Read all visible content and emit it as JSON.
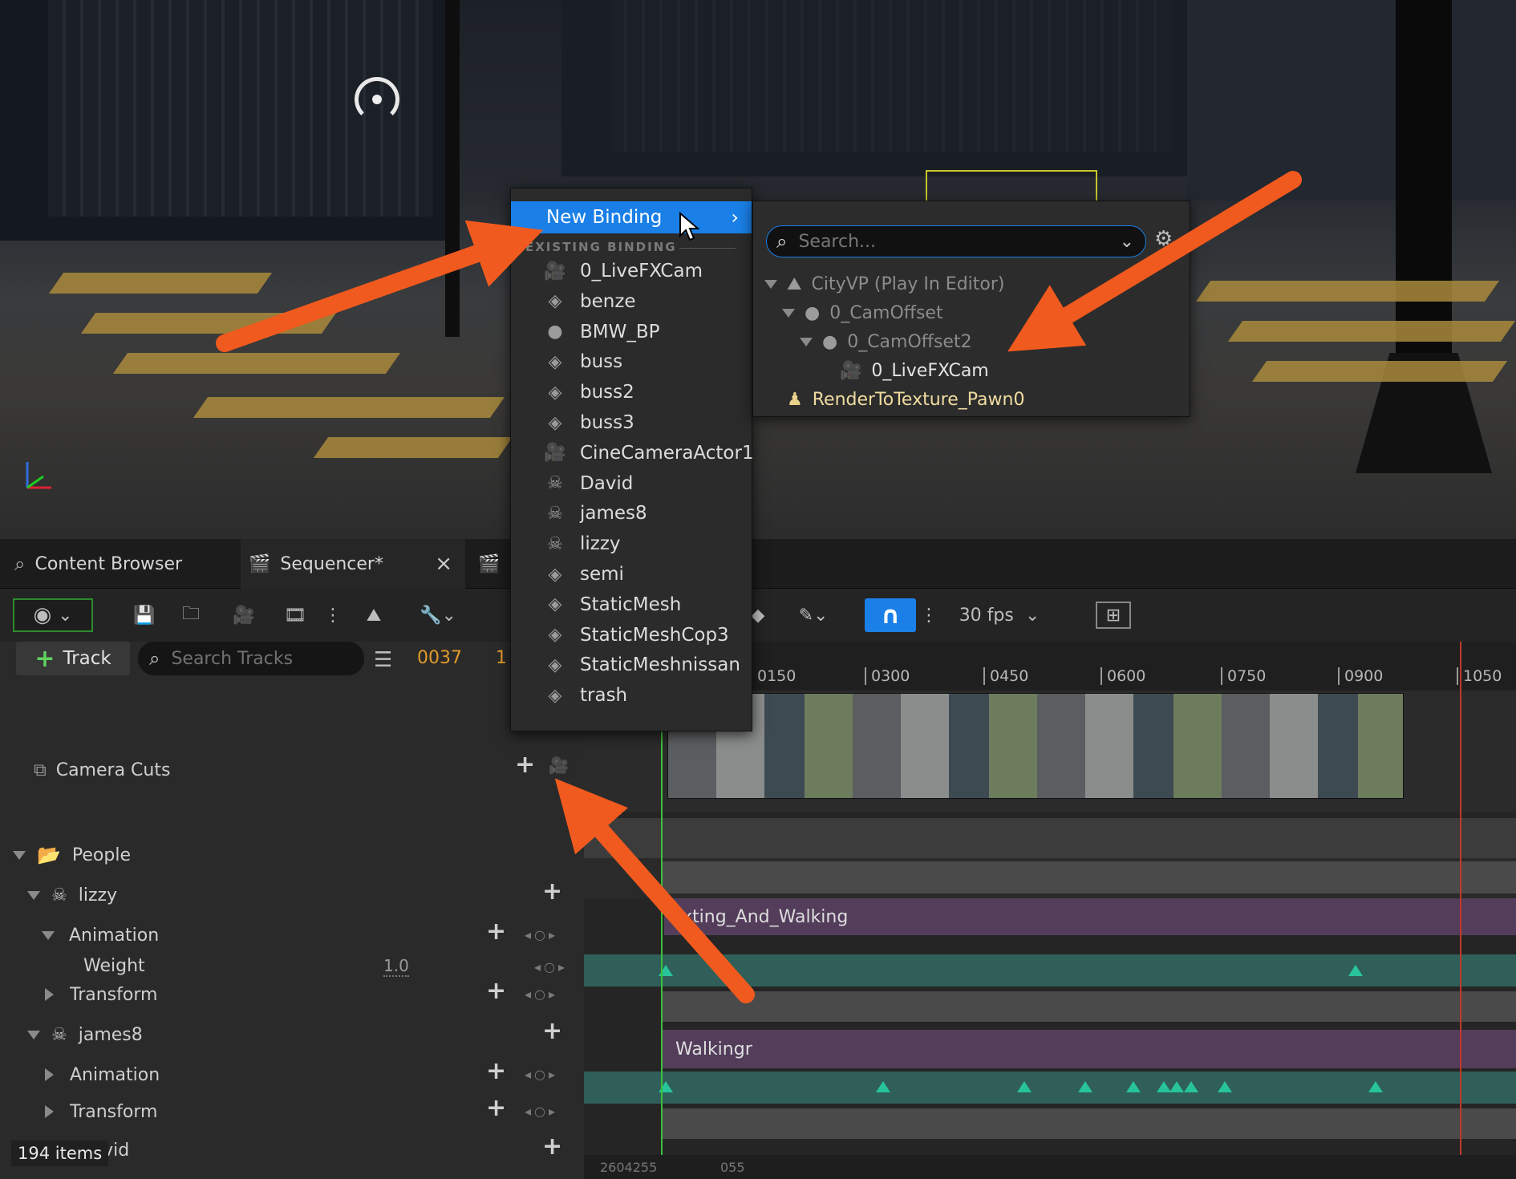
{
  "viewport": {
    "scene": "city street crosswalk"
  },
  "tabs": [
    {
      "label": "Content Browser",
      "icon": "content-browser-icon"
    },
    {
      "label": "Sequencer*",
      "icon": "clapper-icon",
      "close": "×"
    }
  ],
  "toolbar": {
    "fps_label": "30 fps",
    "add_track_label": "Track",
    "search_placeholder": "Search Tracks",
    "current_frame": "0037",
    "second_frame": "1"
  },
  "binding_menu": {
    "new_binding_label": "New Binding",
    "section_header": "EXISTING BINDING",
    "items": [
      {
        "label": "0_LiveFXCam",
        "icon": "camera-icon"
      },
      {
        "label": "benze",
        "icon": "actor-icon"
      },
      {
        "label": "BMW_BP",
        "icon": "blueprint-icon"
      },
      {
        "label": "buss",
        "icon": "actor-icon"
      },
      {
        "label": "buss2",
        "icon": "actor-icon"
      },
      {
        "label": "buss3",
        "icon": "actor-icon"
      },
      {
        "label": "CineCameraActor1",
        "icon": "camera-icon"
      },
      {
        "label": "David",
        "icon": "skeletal-icon"
      },
      {
        "label": "james8",
        "icon": "skeletal-icon"
      },
      {
        "label": "lizzy",
        "icon": "skeletal-icon"
      },
      {
        "label": "semi",
        "icon": "actor-icon"
      },
      {
        "label": "StaticMesh",
        "icon": "actor-icon"
      },
      {
        "label": "StaticMeshCop3",
        "icon": "actor-icon"
      },
      {
        "label": "StaticMeshnissan",
        "icon": "actor-icon"
      },
      {
        "label": "trash",
        "icon": "actor-icon"
      }
    ]
  },
  "submenu": {
    "search_placeholder": "Search...",
    "items": [
      {
        "label": "CityVP (Play In Editor)",
        "icon": "level-icon",
        "depth": 0,
        "dim": true,
        "expanded": true
      },
      {
        "label": "0_CamOffset",
        "icon": "blueprint-icon",
        "depth": 1,
        "dim": true,
        "expanded": true
      },
      {
        "label": "0_CamOffset2",
        "icon": "blueprint-icon",
        "depth": 2,
        "dim": true,
        "expanded": true
      },
      {
        "label": "0_LiveFXCam",
        "icon": "camera-icon",
        "depth": 3,
        "dim": false
      },
      {
        "label": "RenderToTexture_Pawn0",
        "icon": "pawn-icon",
        "depth": 0,
        "dim": false,
        "highlight": true
      }
    ]
  },
  "tree": {
    "camera_cuts": "Camera Cuts",
    "folder": "People",
    "lizzy": "lizzy",
    "animation": "Animation",
    "weight": "Weight",
    "weight_value": "1.0",
    "transform": "Transform",
    "james8": "james8",
    "james_animation": "Animation",
    "james_transform": "Transform",
    "david": "David",
    "items_count": "194 items"
  },
  "timeline": {
    "ticks": [
      "0150",
      "0300",
      "0450",
      "0600",
      "0750",
      "0900",
      "1050"
    ],
    "anim_clip_1": "xting_And_Walking",
    "anim_clip_2": "Walkingr",
    "bottom_readout_1": "2604255",
    "bottom_readout_2": "055"
  },
  "colors": {
    "accent": "#1a7fe6",
    "annotation_arrow": "#f15a1e",
    "anim_track": "#533d5b",
    "transform_track": "#2f5f58",
    "keyframe": "#28c39a"
  }
}
